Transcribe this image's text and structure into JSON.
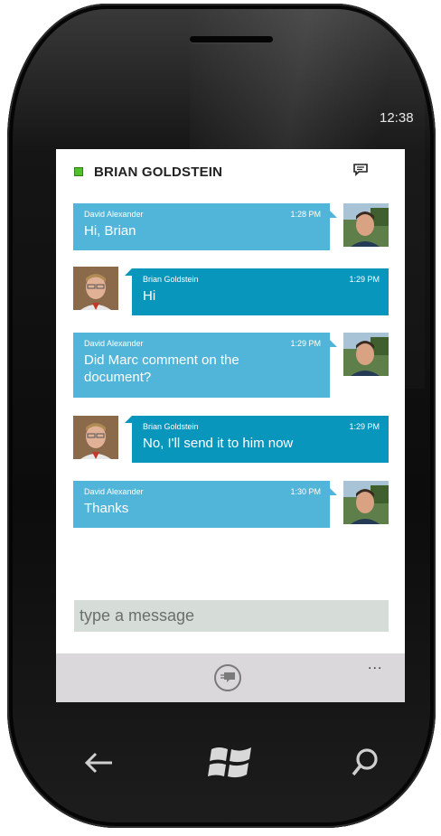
{
  "status_bar": {
    "time": "12:38"
  },
  "conversation": {
    "contact_name": "BRIAN GOLDSTEIN",
    "presence_color": "#4fbf2a",
    "messages": [
      {
        "sender": "David Alexander",
        "time": "1:28 PM",
        "text": "Hi, Brian",
        "side": "them"
      },
      {
        "sender": "Brian Goldstein",
        "time": "1:29 PM",
        "text": "Hi",
        "side": "me"
      },
      {
        "sender": "David Alexander",
        "time": "1:29 PM",
        "text": "Did Marc comment on the document?",
        "side": "them"
      },
      {
        "sender": "Brian Goldstein",
        "time": "1:29 PM",
        "text": "No, I'll send it to him now",
        "side": "me"
      },
      {
        "sender": "David Alexander",
        "time": "1:30 PM",
        "text": "Thanks",
        "side": "them"
      }
    ]
  },
  "compose": {
    "placeholder": "type a message"
  },
  "app_bar": {
    "more": "...",
    "send_icon": "send-message-icon"
  },
  "hardware_keys": [
    "back-arrow-icon",
    "windows-start-icon",
    "search-icon"
  ],
  "colors": {
    "incoming_bubble": "#51b5d9",
    "outgoing_bubble": "#0996bd",
    "app_bar": "#dbd8dc",
    "compose_field": "#d6ddd9"
  }
}
